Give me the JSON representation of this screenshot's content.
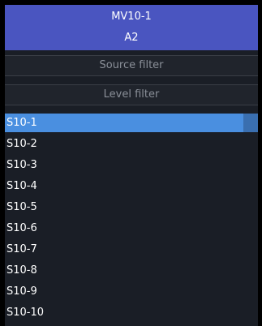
{
  "header": {
    "title": "MV10-1",
    "subtitle": "A2"
  },
  "filters": {
    "source_placeholder": "Source filter",
    "level_placeholder": "Level filter"
  },
  "list": {
    "items": [
      "S10-1",
      "S10-2",
      "S10-3",
      "S10-4",
      "S10-5",
      "S10-6",
      "S10-7",
      "S10-8",
      "S10-9",
      "S10-10"
    ],
    "selected_index": 0
  },
  "colors": {
    "header_bg": "#4a55c0",
    "panel_bg": "#1a1e26",
    "selected_bg": "#4a8fe0",
    "text": "#ffffff",
    "placeholder": "#8a8f98"
  }
}
